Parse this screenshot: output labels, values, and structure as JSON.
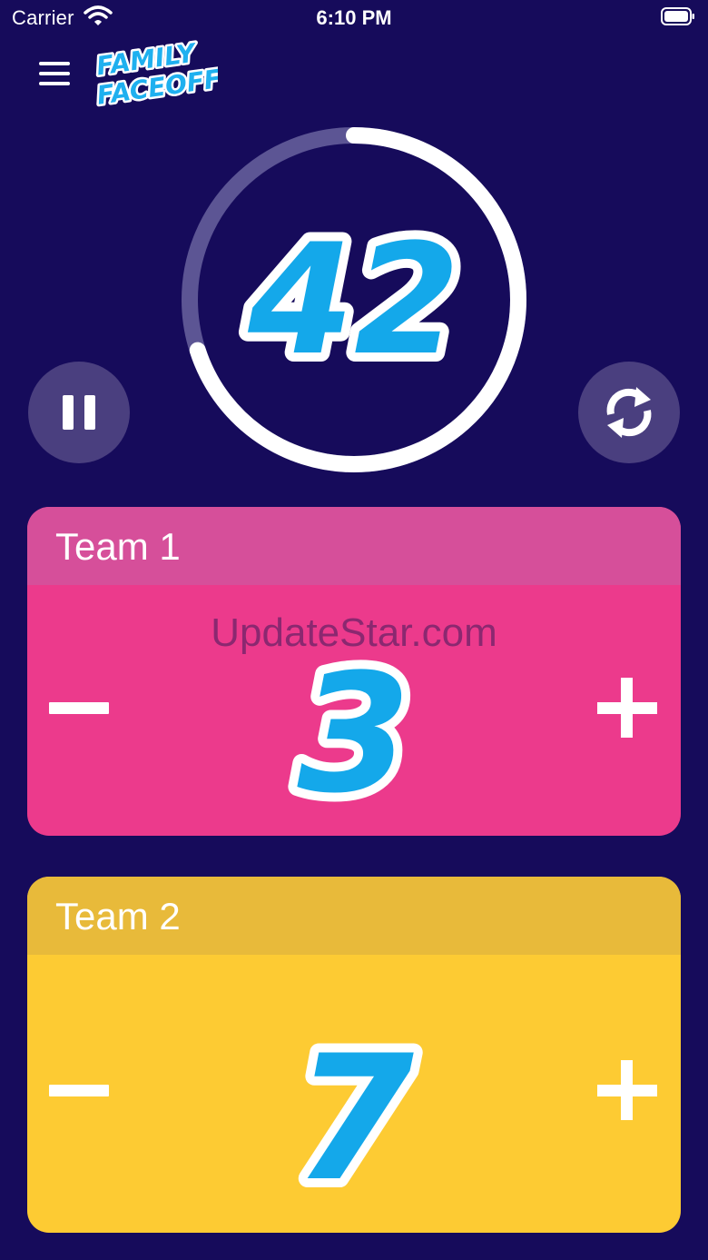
{
  "status_bar": {
    "carrier": "Carrier",
    "time": "6:10 PM",
    "wifi_icon": "wifi-icon",
    "battery_icon": "battery-icon"
  },
  "header": {
    "menu_icon": "hamburger-menu-icon",
    "logo_line1": "FAMILY",
    "logo_line2": "FACEOFF"
  },
  "timer": {
    "value": "42",
    "progress_fraction": 0.7,
    "pause_icon": "pause-icon",
    "reset_icon": "refresh-icon"
  },
  "teams": [
    {
      "name": "Team 1",
      "score": "3",
      "color": "#ec3a8c",
      "header_color": "#d64f9a"
    },
    {
      "name": "Team 2",
      "score": "7",
      "color": "#fdcb33",
      "header_color": "#e8ba3a"
    }
  ],
  "watermark": "UpdateStar.com",
  "colors": {
    "background": "#160b5b",
    "digit_fill": "#14a8ea",
    "button_bg": "#4a3f7f"
  }
}
